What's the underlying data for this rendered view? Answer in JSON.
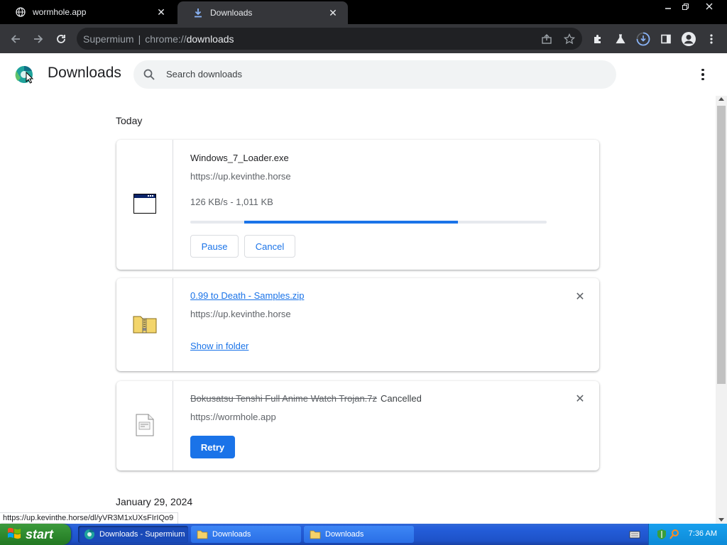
{
  "tabs": [
    {
      "title": "wormhole.app",
      "favicon": "globe-icon",
      "active": false
    },
    {
      "title": "Downloads",
      "favicon": "download-icon",
      "active": true
    }
  ],
  "window_controls": {
    "minimize": "minimize-icon",
    "restore": "restore-icon",
    "close": "close-icon"
  },
  "toolbar": {
    "omnibox": {
      "site_label": "Supermium",
      "separator": "|",
      "scheme": "chrome://",
      "path": "downloads"
    }
  },
  "page": {
    "title": "Downloads",
    "search_placeholder": "Search downloads"
  },
  "groups": [
    {
      "date": "Today",
      "items": [
        {
          "filename": "Windows_7_Loader.exe",
          "source": "https://up.kevinthe.horse",
          "status": "126 KB/s - 1,011 KB",
          "progress": 0.75,
          "icon": "window-app-icon",
          "actions": {
            "pause": "Pause",
            "cancel": "Cancel"
          }
        },
        {
          "filename": "0.99 to Death - Samples.zip",
          "source": "https://up.kevinthe.horse",
          "action": "Show in folder",
          "icon": "zip-folder-icon"
        },
        {
          "filename": "Bokusatsu Tenshi Full Anime Watch Trojan.7z",
          "source": "https://wormhole.app",
          "status": "Cancelled",
          "action": "Retry",
          "icon": "archive-file-icon"
        }
      ]
    },
    {
      "date": "January 29, 2024",
      "items": []
    }
  ],
  "status_bubble": "https://up.kevinthe.horse/dl/yVR3M1xUXsFIrIQo9",
  "taskbar": {
    "start_label": "start",
    "tasks": [
      {
        "label": "Downloads - Supermium",
        "icon": "browser-icon",
        "active": true
      },
      {
        "label": "Downloads",
        "icon": "folder-icon",
        "active": false
      },
      {
        "label": "Downloads",
        "icon": "folder-icon",
        "active": false
      }
    ],
    "clock": "7:36 AM"
  },
  "colors": {
    "accent": "#1a73e8",
    "taskbar": "#245edb",
    "start": "#2f8a2f"
  }
}
